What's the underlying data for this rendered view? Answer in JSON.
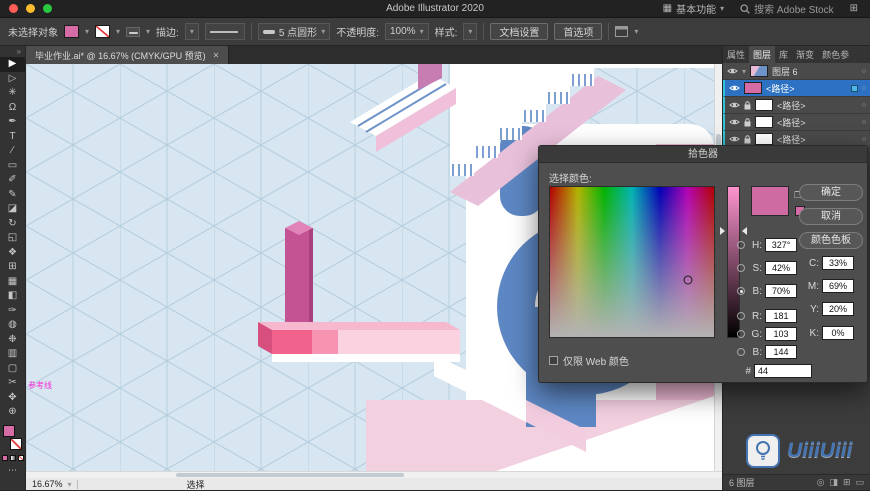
{
  "icons": {
    "caret_down": "▾",
    "expand_caret": "▾",
    "double_chevron": "»",
    "close": "✕",
    "ellipsis": "⋯",
    "workspace": "▦",
    "apps_grid": "⊞",
    "target_circle": "○",
    "gamut_cube": "❒"
  },
  "titlebar": {
    "title": "Adobe Illustrator 2020",
    "workspace_label": "基本功能",
    "search_label": "搜索 Adobe Stock"
  },
  "controlbar": {
    "status": "未选择对象",
    "stroke_label": "描边:",
    "brush_name": "5 点圆形",
    "opacity_label": "不透明度:",
    "opacity_value": "100%",
    "style_label": "样式:",
    "doc_setup": "文档设置",
    "preferences": "首选项"
  },
  "document": {
    "tab_title": "毕业作业.ai* @ 16.67% (CMYK/GPU 预览)"
  },
  "toolbar": {
    "tools": [
      {
        "name": "selection",
        "glyph": "▶"
      },
      {
        "name": "direct-selection",
        "glyph": "▷"
      },
      {
        "name": "magic-wand",
        "glyph": "✳"
      },
      {
        "name": "lasso",
        "glyph": "Ω"
      },
      {
        "name": "pen",
        "glyph": "✒"
      },
      {
        "name": "type",
        "glyph": "T"
      },
      {
        "name": "line-segment",
        "glyph": "∕"
      },
      {
        "name": "rectangle",
        "glyph": "▭"
      },
      {
        "name": "paintbrush",
        "glyph": "✐"
      },
      {
        "name": "pencil",
        "glyph": "✎"
      },
      {
        "name": "eraser",
        "glyph": "◪"
      },
      {
        "name": "rotate",
        "glyph": "↻"
      },
      {
        "name": "scale",
        "glyph": "◱"
      },
      {
        "name": "shape-builder",
        "glyph": "❖"
      },
      {
        "name": "perspective-grid",
        "glyph": "⊞"
      },
      {
        "name": "mesh",
        "glyph": "▦"
      },
      {
        "name": "gradient",
        "glyph": "◧"
      },
      {
        "name": "eyedropper",
        "glyph": "✑"
      },
      {
        "name": "blend",
        "glyph": "◍"
      },
      {
        "name": "symbol-sprayer",
        "glyph": "❉"
      },
      {
        "name": "column-graph",
        "glyph": "▥"
      },
      {
        "name": "artboard",
        "glyph": "▢"
      },
      {
        "name": "slice",
        "glyph": "✂"
      },
      {
        "name": "hand",
        "glyph": "✥"
      },
      {
        "name": "zoom",
        "glyph": "⊕"
      }
    ]
  },
  "picker": {
    "title": "拾色器",
    "select_label": "选择颜色:",
    "buttons": {
      "ok": "确定",
      "cancel": "取消",
      "swatches": "颜色色板"
    },
    "web_only_label": "仅限 Web 颜色",
    "selected_channel": "B",
    "current_color": "#cf6ba3",
    "hsb": [
      {
        "label": "H:",
        "value": "327°"
      },
      {
        "label": "S:",
        "value": "42%"
      },
      {
        "label": "B:",
        "value": "70%"
      }
    ],
    "rgb": [
      {
        "label": "R:",
        "value": "181"
      },
      {
        "label": "G:",
        "value": "103"
      },
      {
        "label": "B:",
        "value": "144"
      }
    ],
    "hex_label": "#",
    "hex_value": "44",
    "cmyk": [
      {
        "label": "C:",
        "value": "33%"
      },
      {
        "label": "M:",
        "value": "69%"
      },
      {
        "label": "Y:",
        "value": "20%"
      },
      {
        "label": "K:",
        "value": "0%"
      }
    ]
  },
  "layers_panel": {
    "tabs": [
      "属性",
      "图层",
      "库",
      "渐变",
      "颜色参"
    ],
    "active_tab": "图层",
    "rows": [
      {
        "name": "图层 6"
      },
      {
        "name": "<路径>"
      },
      {
        "name": "<路径>"
      },
      {
        "name": "<路径>"
      },
      {
        "name": "<路径>"
      }
    ],
    "status": "6 图层",
    "footer_icons": [
      {
        "name": "locate-object",
        "glyph": "◎"
      },
      {
        "name": "make-mask",
        "glyph": "◨"
      },
      {
        "name": "new-layer",
        "glyph": "⊞"
      },
      {
        "name": "delete-layer",
        "glyph": "▭"
      }
    ]
  },
  "statusbar": {
    "zoom": "16.67%",
    "tool": "选择"
  },
  "canvas": {
    "guide_label": "参考线"
  },
  "watermark": {
    "text": "UiiiUiii"
  }
}
